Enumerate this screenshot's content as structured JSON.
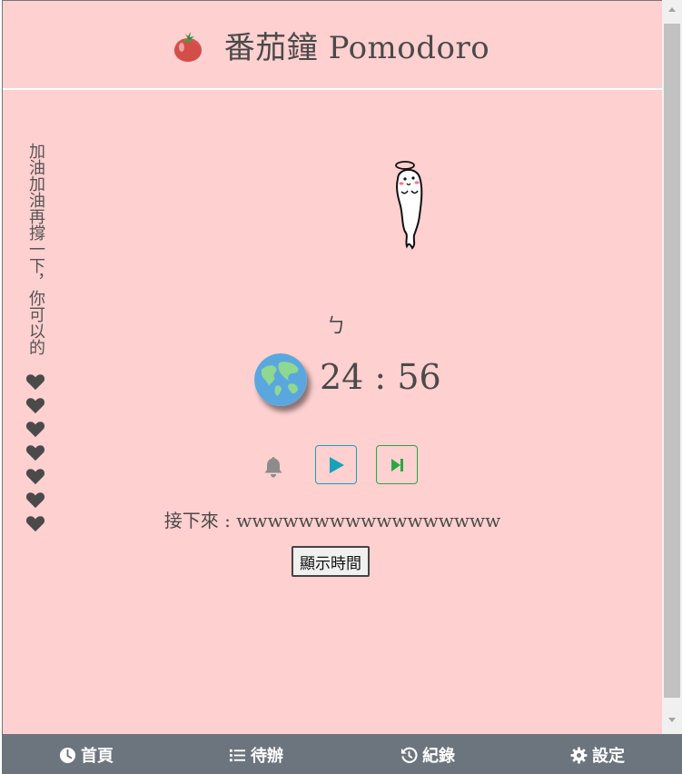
{
  "header": {
    "logo_icon": "tomato-icon",
    "title": "番茄鐘 Pomodoro"
  },
  "sidebar": {
    "encouragement": "加油加油再撐一下，你可以的",
    "hearts_count": 7,
    "heart_icon": "heart-icon"
  },
  "main": {
    "mascot_icon": "ghost-icon",
    "label": "ㄅ",
    "earth_icon": "earth-icon",
    "timer": "24 : 56",
    "bell_icon": "bell-icon",
    "play_icon": "play-icon",
    "skip_icon": "skip-forward-icon",
    "next_text": "接下來 : wwwwwwwwwwwwwwwww",
    "show_time_button": "顯示時間"
  },
  "nav": {
    "home": "首頁",
    "todo": "待辦",
    "history": "紀錄",
    "settings": "設定"
  },
  "colors": {
    "background": "#ffd0d0",
    "nav_bar": "#6c757d",
    "play_border": "#18a2b8",
    "skip_border": "#28a745"
  }
}
